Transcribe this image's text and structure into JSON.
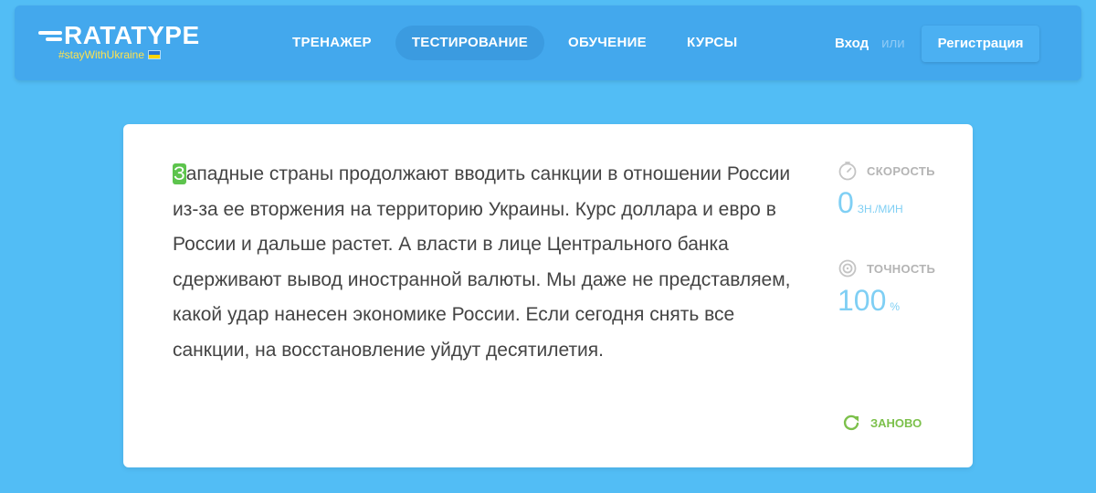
{
  "logo": {
    "name": "RATATYPE",
    "tagline": "#stayWithUkraine"
  },
  "nav": {
    "items": [
      {
        "label": "ТРЕНАЖЕР"
      },
      {
        "label": "ТЕСТИРОВАНИЕ",
        "active": true
      },
      {
        "label": "ОБУЧЕНИЕ"
      },
      {
        "label": "КУРСЫ"
      }
    ]
  },
  "auth": {
    "login": "Вход",
    "or": "или",
    "register": "Регистрация"
  },
  "typing": {
    "current_char": "З",
    "remaining_text": "ападные страны продолжают вводить санкции в отношении России из-за ее вторжения на территорию Украины. Курс доллара и евро в России и дальше растет. А власти в лице Центрального банка сдерживают вывод иностранной валюты. Мы даже не представляем, какой удар нанесен экономике России. Если сегодня снять все санкции, на восстановление уйдут десятилетия."
  },
  "stats": {
    "speed_label": "СКОРОСТЬ",
    "speed_value": "0",
    "speed_unit": "ЗН./МИН",
    "accuracy_label": "ТОЧНОСТЬ",
    "accuracy_value": "100",
    "accuracy_unit": "%"
  },
  "restart_label": "ЗАНОВО",
  "colors": {
    "background": "#52bdf5",
    "header": "#43a8ed",
    "cursor_highlight": "#5dc44d",
    "stat_value": "#7fcff4",
    "restart": "#7cc04b"
  },
  "icons": {
    "speed": "stopwatch-icon",
    "accuracy": "target-icon",
    "restart": "refresh-icon"
  }
}
